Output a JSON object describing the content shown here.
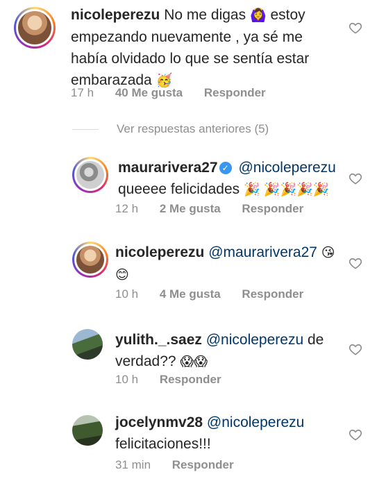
{
  "comments": [
    {
      "username": "nicoleperezu",
      "text_1": " No me digas ",
      "emoji_1": "🙆‍♀️",
      "text_2": " estoy empezando nuevamente , ya sé me había olvidado lo que se sentía estar embarazada ",
      "emoji_2": "🥳",
      "time": "17 h",
      "likes": "40 Me gusta",
      "reply": "Responder"
    }
  ],
  "view_replies": "Ver respuestas anteriores (5)",
  "replies": [
    {
      "username": "maurarivera27",
      "verified": "✓",
      "mention": "@nicoleperezu",
      "text": "queeee felicidades ",
      "emoji": "🎉 🎉🎉🎉🎉",
      "time": "12 h",
      "likes": "2 Me gusta",
      "reply": "Responder"
    },
    {
      "username": "nicoleperezu",
      "mention": "@maurarivera27",
      "emoji_1": "😘",
      "emoji_2": "😊",
      "time": "10 h",
      "likes": "4 Me gusta",
      "reply": "Responder"
    },
    {
      "username": "yulith._.saez",
      "mention": "@nicoleperezu",
      "text_1": " de verdad?? ",
      "emoji": "😱😱",
      "time": "10 h",
      "reply": "Responder"
    },
    {
      "username": "jocelynmv28",
      "mention": "@nicoleperezu",
      "text": "felicitaciones!!!",
      "time": "31 min",
      "reply": "Responder"
    }
  ],
  "icons": {
    "like": "heart-outline-icon",
    "verified": "verified-badge-icon"
  },
  "colors": {
    "text": "#262626",
    "muted": "#8e8e8e",
    "mention": "#00376b",
    "verified": "#3897f0"
  }
}
